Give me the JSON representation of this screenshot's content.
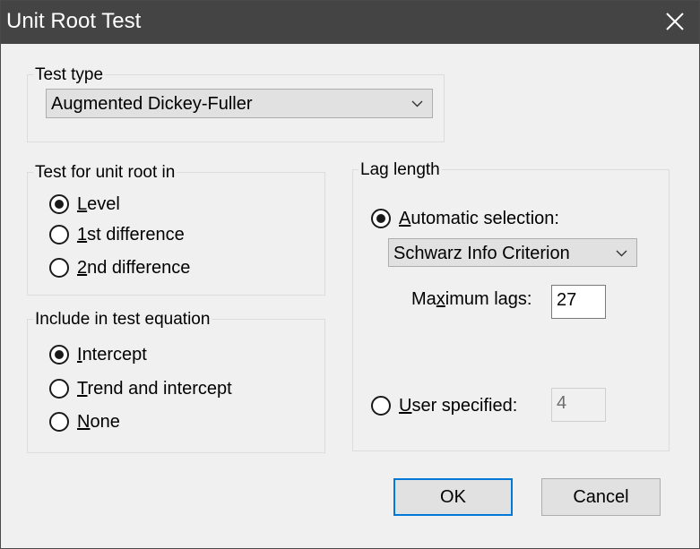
{
  "window": {
    "title": "Unit Root Test",
    "close_icon": "close-icon"
  },
  "test_type": {
    "label": "Test type",
    "selected": "Augmented Dickey-Fuller"
  },
  "unit_root_in": {
    "label": "Test for unit root in",
    "options": [
      {
        "prefix": "",
        "mnemonic": "L",
        "rest": "evel",
        "checked": true
      },
      {
        "prefix": "",
        "mnemonic": "1",
        "rest": "st difference",
        "checked": false
      },
      {
        "prefix": "",
        "mnemonic": "2",
        "rest": "nd difference",
        "checked": false
      }
    ]
  },
  "include": {
    "label": "Include in test equation",
    "options": [
      {
        "prefix": "",
        "mnemonic": "I",
        "rest": "ntercept",
        "checked": true
      },
      {
        "prefix": "",
        "mnemonic": "T",
        "rest": "rend and intercept",
        "checked": false
      },
      {
        "prefix": "",
        "mnemonic": "N",
        "rest": "one",
        "checked": false
      }
    ]
  },
  "lag_length": {
    "label": "Lag length",
    "automatic": {
      "prefix": "",
      "mnemonic": "A",
      "rest": "utomatic selection:",
      "checked": true
    },
    "criterion": "Schwarz Info Criterion",
    "max_lags": {
      "prefix": "Ma",
      "mnemonic": "x",
      "rest": "imum lags:",
      "value": "27"
    },
    "user": {
      "prefix": "",
      "mnemonic": "U",
      "rest": "ser specified:",
      "checked": false,
      "value": "4"
    }
  },
  "buttons": {
    "ok": "OK",
    "cancel": "Cancel"
  }
}
